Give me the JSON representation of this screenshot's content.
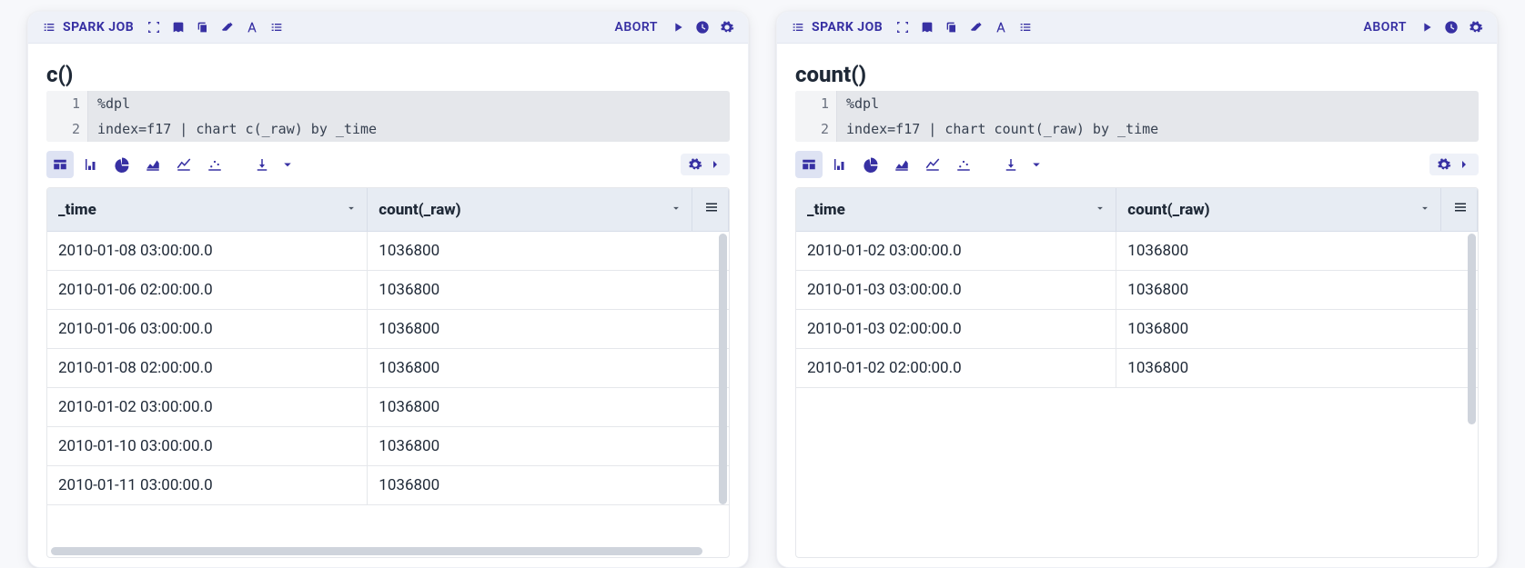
{
  "panels": [
    {
      "header": {
        "spark_label": "SPARK JOB",
        "abort_label": "ABORT"
      },
      "cell_title": "c()",
      "code_lines": [
        {
          "n": "1",
          "t": "%dpl"
        },
        {
          "n": "2",
          "t": "index=f17 | chart c(_raw) by _time"
        }
      ],
      "table": {
        "columns": [
          "_time",
          "count(_raw)"
        ],
        "rows": [
          [
            "2010-01-08 03:00:00.0",
            "1036800"
          ],
          [
            "2010-01-06 02:00:00.0",
            "1036800"
          ],
          [
            "2010-01-06 03:00:00.0",
            "1036800"
          ],
          [
            "2010-01-08 02:00:00.0",
            "1036800"
          ],
          [
            "2010-01-02 03:00:00.0",
            "1036800"
          ],
          [
            "2010-01-10 03:00:00.0",
            "1036800"
          ],
          [
            "2010-01-11 03:00:00.0",
            "1036800"
          ]
        ]
      }
    },
    {
      "header": {
        "spark_label": "SPARK JOB",
        "abort_label": "ABORT"
      },
      "cell_title": "count()",
      "code_lines": [
        {
          "n": "1",
          "t": "%dpl"
        },
        {
          "n": "2",
          "t": "index=f17 | chart count(_raw) by _time"
        }
      ],
      "table": {
        "columns": [
          "_time",
          "count(_raw)"
        ],
        "rows": [
          [
            "2010-01-02 03:00:00.0",
            "1036800"
          ],
          [
            "2010-01-03 03:00:00.0",
            "1036800"
          ],
          [
            "2010-01-03 02:00:00.0",
            "1036800"
          ],
          [
            "2010-01-02 02:00:00.0",
            "1036800"
          ]
        ]
      }
    }
  ]
}
